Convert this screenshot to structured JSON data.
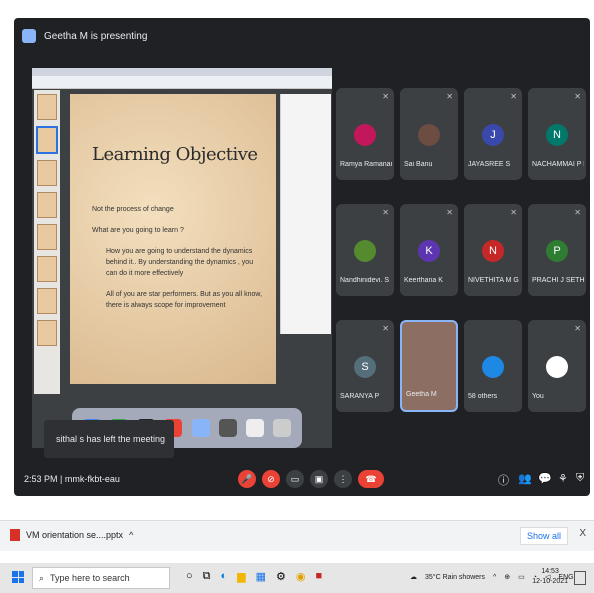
{
  "meet": {
    "presenting_banner": "Geetha M is presenting",
    "slide": {
      "title": "Learning Objective",
      "bullets": [
        "Not the process of change",
        "What are you going to learn ?",
        "How you are going to understand the dynamics behind it.. By understanding the dynamics , you can do it more effectively",
        "All of you are star performers. But as you all know, there is always scope for improvement"
      ]
    },
    "toast": "sithal s has left the meeting",
    "participants": [
      {
        "name": "Ramya Ramanan",
        "initial": "",
        "color": "#c2185b"
      },
      {
        "name": "Sai Banu",
        "initial": "",
        "color": "#6d4c41"
      },
      {
        "name": "JAYASREE S",
        "initial": "J",
        "color": "#3949ab"
      },
      {
        "name": "NACHAMMAI P L",
        "initial": "N",
        "color": "#00796b"
      },
      {
        "name": "Nandhinidevi. S",
        "initial": "",
        "color": "#558b2f"
      },
      {
        "name": "Keerthana K",
        "initial": "K",
        "color": "#5e35b1"
      },
      {
        "name": "NIVETHITA M G",
        "initial": "N",
        "color": "#c62828"
      },
      {
        "name": "PRACHI J SETHI...",
        "initial": "P",
        "color": "#2e7d32"
      },
      {
        "name": "SARANYA P",
        "initial": "S",
        "color": "#546e7a"
      },
      {
        "name": "Geetha M",
        "initial": "",
        "color": "#8d6e63"
      },
      {
        "name": "58 others",
        "initial": "",
        "color": "#1e88e5"
      },
      {
        "name": "You",
        "initial": "",
        "color": "#ffffff"
      }
    ],
    "time_code": "2:53 PM | mmk-fkbt-eau"
  },
  "downloads": {
    "file_name": "VM orientation se....pptx",
    "show_all": "Show all",
    "close": "X"
  },
  "taskbar": {
    "search_placeholder": "Type here to search",
    "weather": "35°C Rain showers",
    "lang": "ENG",
    "time": "14:53",
    "date": "12-10-2021"
  }
}
